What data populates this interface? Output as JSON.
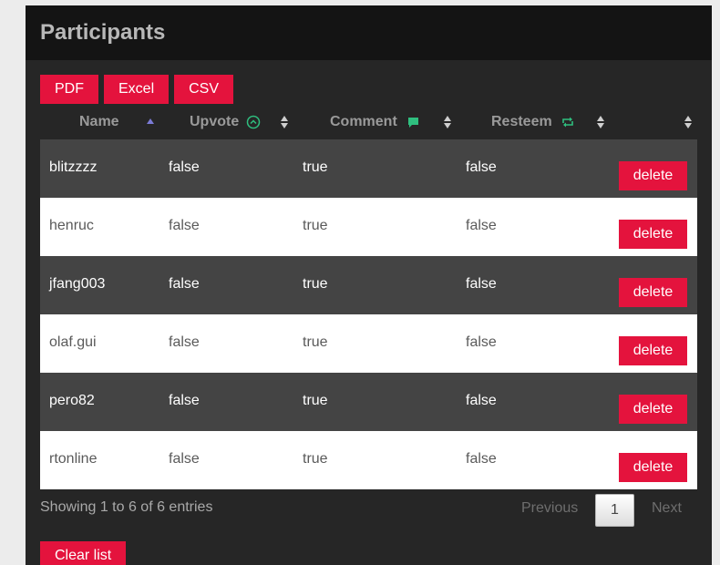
{
  "panel": {
    "title": "Participants"
  },
  "export_buttons": [
    "PDF",
    "Excel",
    "CSV"
  ],
  "table": {
    "columns": [
      {
        "label": "Name",
        "icon": "sort-asc-icon"
      },
      {
        "label": "Upvote",
        "icon": "upvote-icon"
      },
      {
        "label": "Comment",
        "icon": "comment-icon"
      },
      {
        "label": "Resteem",
        "icon": "resteem-icon"
      },
      {
        "label": "",
        "icon": ""
      }
    ],
    "rows": [
      {
        "name": "blitzzzz",
        "upvote": "false",
        "comment": "true",
        "resteem": "false"
      },
      {
        "name": "henruc",
        "upvote": "false",
        "comment": "true",
        "resteem": "false"
      },
      {
        "name": "jfang003",
        "upvote": "false",
        "comment": "true",
        "resteem": "false"
      },
      {
        "name": "olaf.gui",
        "upvote": "false",
        "comment": "true",
        "resteem": "false"
      },
      {
        "name": "pero82",
        "upvote": "false",
        "comment": "true",
        "resteem": "false"
      },
      {
        "name": "rtonline",
        "upvote": "false",
        "comment": "true",
        "resteem": "false"
      }
    ],
    "delete_label": "delete"
  },
  "footer": {
    "info": "Showing 1 to 6 of 6 entries",
    "previous": "Previous",
    "page": "1",
    "next": "Next",
    "clear_label": "Clear list"
  },
  "colors": {
    "accent": "#e4133d",
    "icon_green": "#2fbf7f",
    "sort_active": "#7b7bd6"
  }
}
